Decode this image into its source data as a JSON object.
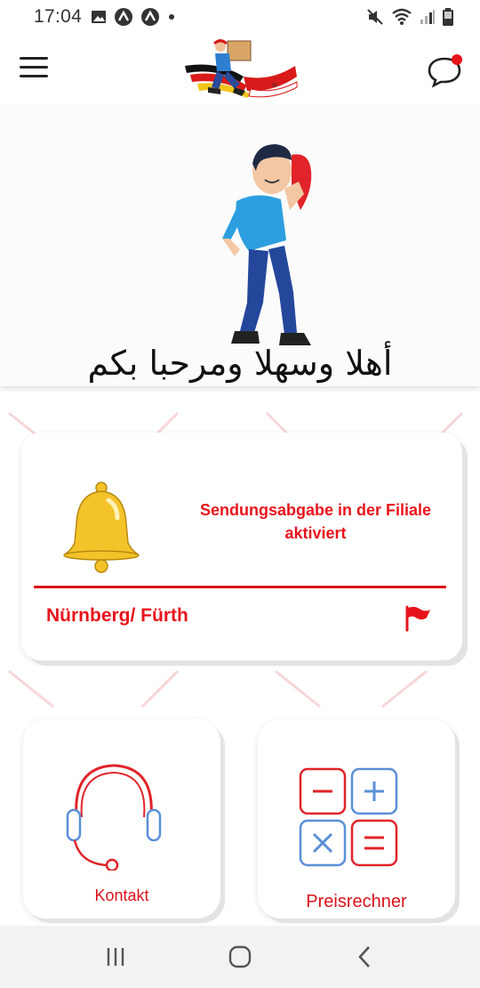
{
  "status_bar": {
    "time": "17:04"
  },
  "header": {
    "logo_icon": "delivery-courier-logo",
    "menu_icon": "hamburger-menu-icon",
    "chat_icon": "chat-bubble-icon",
    "has_unread_dot": true
  },
  "banner": {
    "greeting": "أهلا وسهلا ومرحبا بكم"
  },
  "notification_card": {
    "message": "Sendungsabgabe in der Filiale aktiviert",
    "location": "Nürnberg/ Fürth",
    "icon": "bell-icon",
    "location_icon": "flag-icon"
  },
  "tiles": {
    "contact": {
      "label": "Kontakt",
      "icon": "headset-icon"
    },
    "price_calculator": {
      "label": "Preisrechner",
      "icon": "calculator-icon"
    }
  },
  "colors": {
    "accent": "#e8141c",
    "calc_blue": "#5a8fd8",
    "bell_yellow": "#f4c32a"
  }
}
